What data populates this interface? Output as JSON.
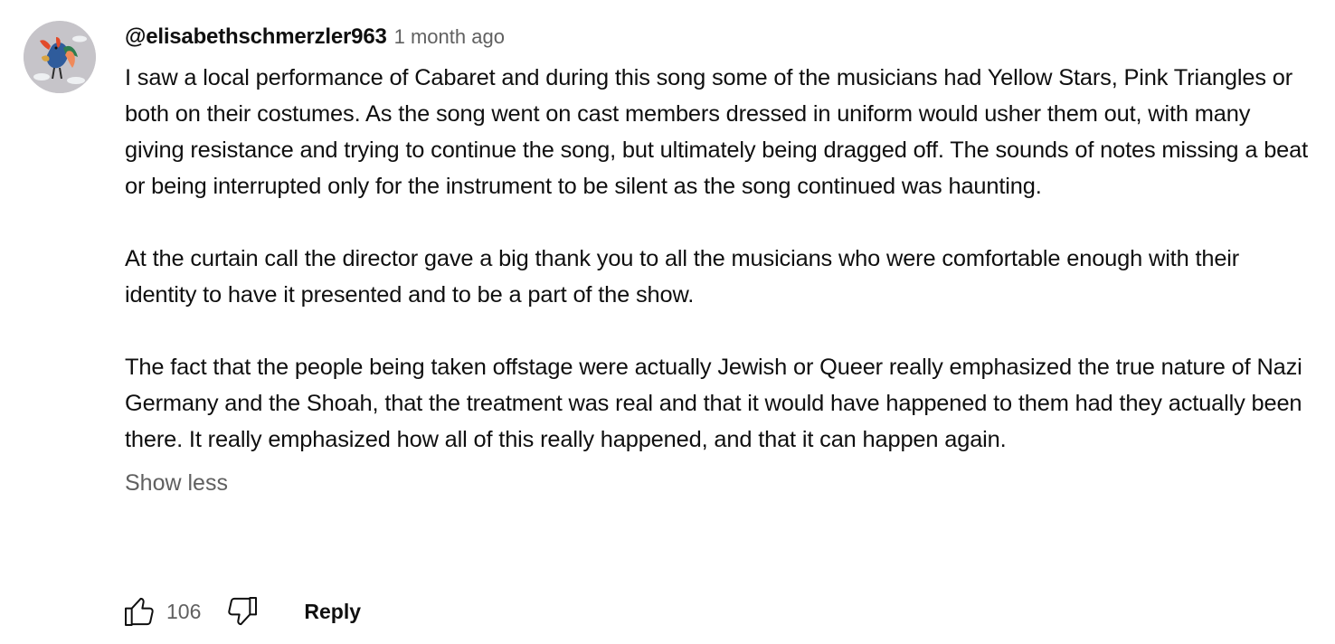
{
  "comment": {
    "author": "@elisabethschmerzler963",
    "timestamp": "1 month ago",
    "paragraphs": [
      "I saw a local performance of Cabaret and during this song some of the musicians had Yellow Stars, Pink Triangles or both on their costumes. As the song went on cast members dressed in uniform would usher them out, with many giving resistance and trying to continue the song, but ultimately being dragged off. The sounds of notes missing a beat or being interrupted only for the instrument to be silent as the song continued was haunting.",
      "At the curtain call the director gave a big thank you to all the musicians who were comfortable enough with their identity to have it presented and to be a part of the show.",
      "The fact that the people being taken offstage were actually Jewish or Queer really emphasized the true nature of Nazi Germany and the Shoah, that the treatment was real and that it would have happened to them had they actually been there. It really emphasized how all of this really happened, and that it can happen again."
    ],
    "show_less_label": "Show less",
    "like_count": "106",
    "reply_label": "Reply"
  },
  "icons": {
    "like": "thumbs-up-icon",
    "dislike": "thumbs-down-icon",
    "avatar": "rooster-illustration"
  },
  "colors": {
    "text_primary": "#0f0f0f",
    "text_secondary": "#606060",
    "background": "#ffffff"
  }
}
